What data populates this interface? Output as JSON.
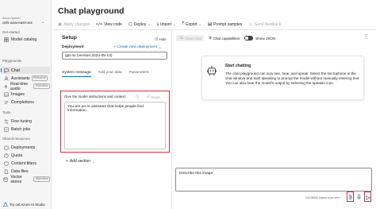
{
  "nav": {
    "resource_sub": "Azure OpenAI",
    "resource_name": "oshi-aoai-east-us2",
    "sections": {
      "get_started": "Get started",
      "playgrounds": "Playgrounds",
      "tools": "Tools",
      "shared": "Shared resources"
    },
    "items": {
      "model_catalog": "Model catalog",
      "chat": "Chat",
      "assistants": "Assistants",
      "realtime": "Real-time audio",
      "images": "Images",
      "completions": "Completions",
      "fine_tuning": "Fine-tuning",
      "batch_jobs": "Batch jobs",
      "deployments": "Deployments",
      "quota": "Quota",
      "content_filters": "Content filters",
      "data_files": "Data files",
      "vector_stores": "Vector stores"
    },
    "preview_badge": "PREVIEW",
    "footer": "Try out Azure AI Studio"
  },
  "header": {
    "title": "Chat playground",
    "toolbar": {
      "apply_changes": "Apply changes",
      "view_code": "View code",
      "deploy": "Deploy",
      "import": "Import",
      "export": "Export",
      "prompt_samples": "Prompt samples",
      "send_feedback": "Send feedback"
    }
  },
  "setup": {
    "title": "Setup",
    "hide": "Hide",
    "deployment_label": "Deployment",
    "deployment_value": "gpt-4o (version:2024-05-13)",
    "create_new": "Create new deployment",
    "tabs": [
      "System message",
      "Add your data",
      "Parameters"
    ],
    "instructions_label": "Give the model instructions and context",
    "reset": "Reset",
    "system_message": "You are an AI assistant that helps people find information.",
    "add_section": "Add section"
  },
  "chat": {
    "clear_chat": "Clear chat",
    "chat_capabilities": "Chat capabilities",
    "show_json": "Show JSON",
    "start_title": "Start chatting",
    "start_text": "The chat playground can now see, hear, and speak. Select the microphone in the chat window and start speaking to prompt the model without manually entering text. You can also hear the model's output by selecting the speaker icon.",
    "input_value": "Describe this image",
    "tokens": "14/128000 tokens to be sent"
  },
  "colors": {
    "accent": "#0f6cbd",
    "highlight": "#d13438"
  },
  "icons": [
    "search-icon",
    "chat-icon",
    "image-icon",
    "attach-icon",
    "mic-icon",
    "send-icon",
    "robot-icon"
  ]
}
